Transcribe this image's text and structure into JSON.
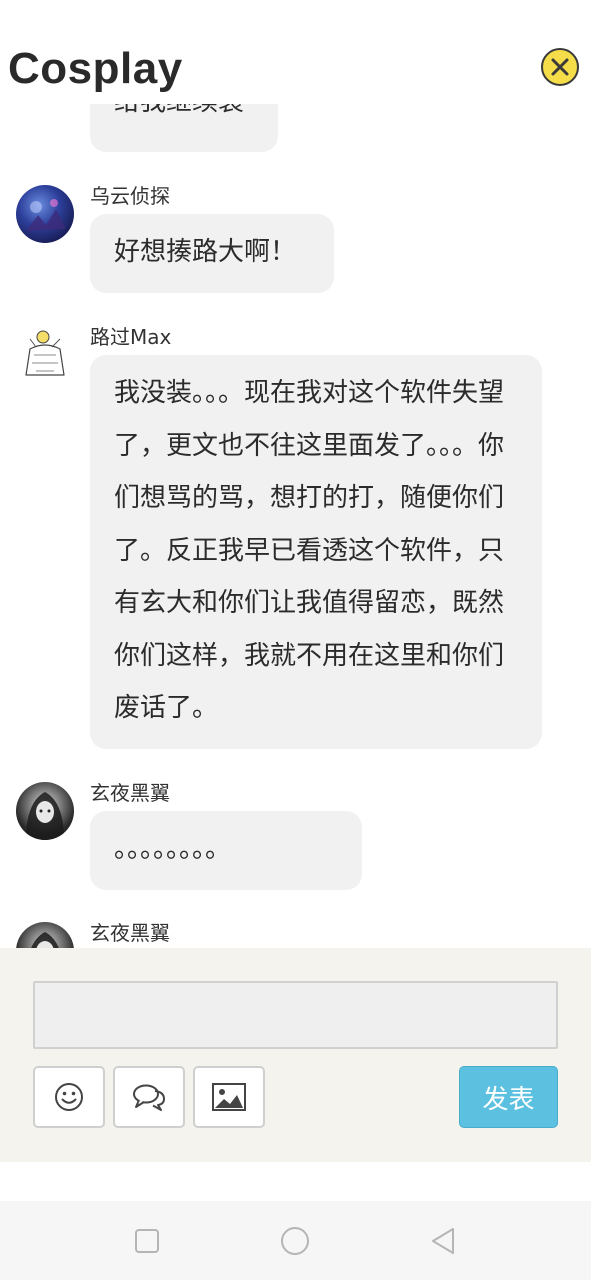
{
  "header": {
    "title": "Cosplay",
    "close_icon": "close-circle-icon",
    "close_color": "#f5dd4a"
  },
  "messages": [
    {
      "user": "",
      "text": "给我继续装",
      "partial": true
    },
    {
      "user": "乌云侦探",
      "text": "好想揍路大啊！",
      "avatar": "anime-avatar-blue"
    },
    {
      "user": "路过Max",
      "text": "我没装。。。现在我对这个软件失望了，更文也不往这里面发了。。。你们想骂的骂，想打的打，随便你们了。反正我早已看透这个软件，只有玄大和你们让我值得留恋，既然你们这样，我就不用在这里和你们废话了。",
      "avatar": "sketch-avatar"
    },
    {
      "user": "玄夜黑翼",
      "text": "。。。。。。。。",
      "avatar": "dark-anime-avatar"
    },
    {
      "user": "玄夜黑翼",
      "text": "",
      "avatar": "dark-anime-avatar"
    }
  ],
  "composer": {
    "input_value": "",
    "emoji_icon": "smiley-icon",
    "chat_icon": "chat-bubbles-icon",
    "image_icon": "image-icon",
    "send_label": "发表",
    "send_color": "#5cc1e0"
  },
  "navbar": {
    "recent_icon": "square-icon",
    "home_icon": "circle-icon",
    "back_icon": "triangle-back-icon"
  }
}
